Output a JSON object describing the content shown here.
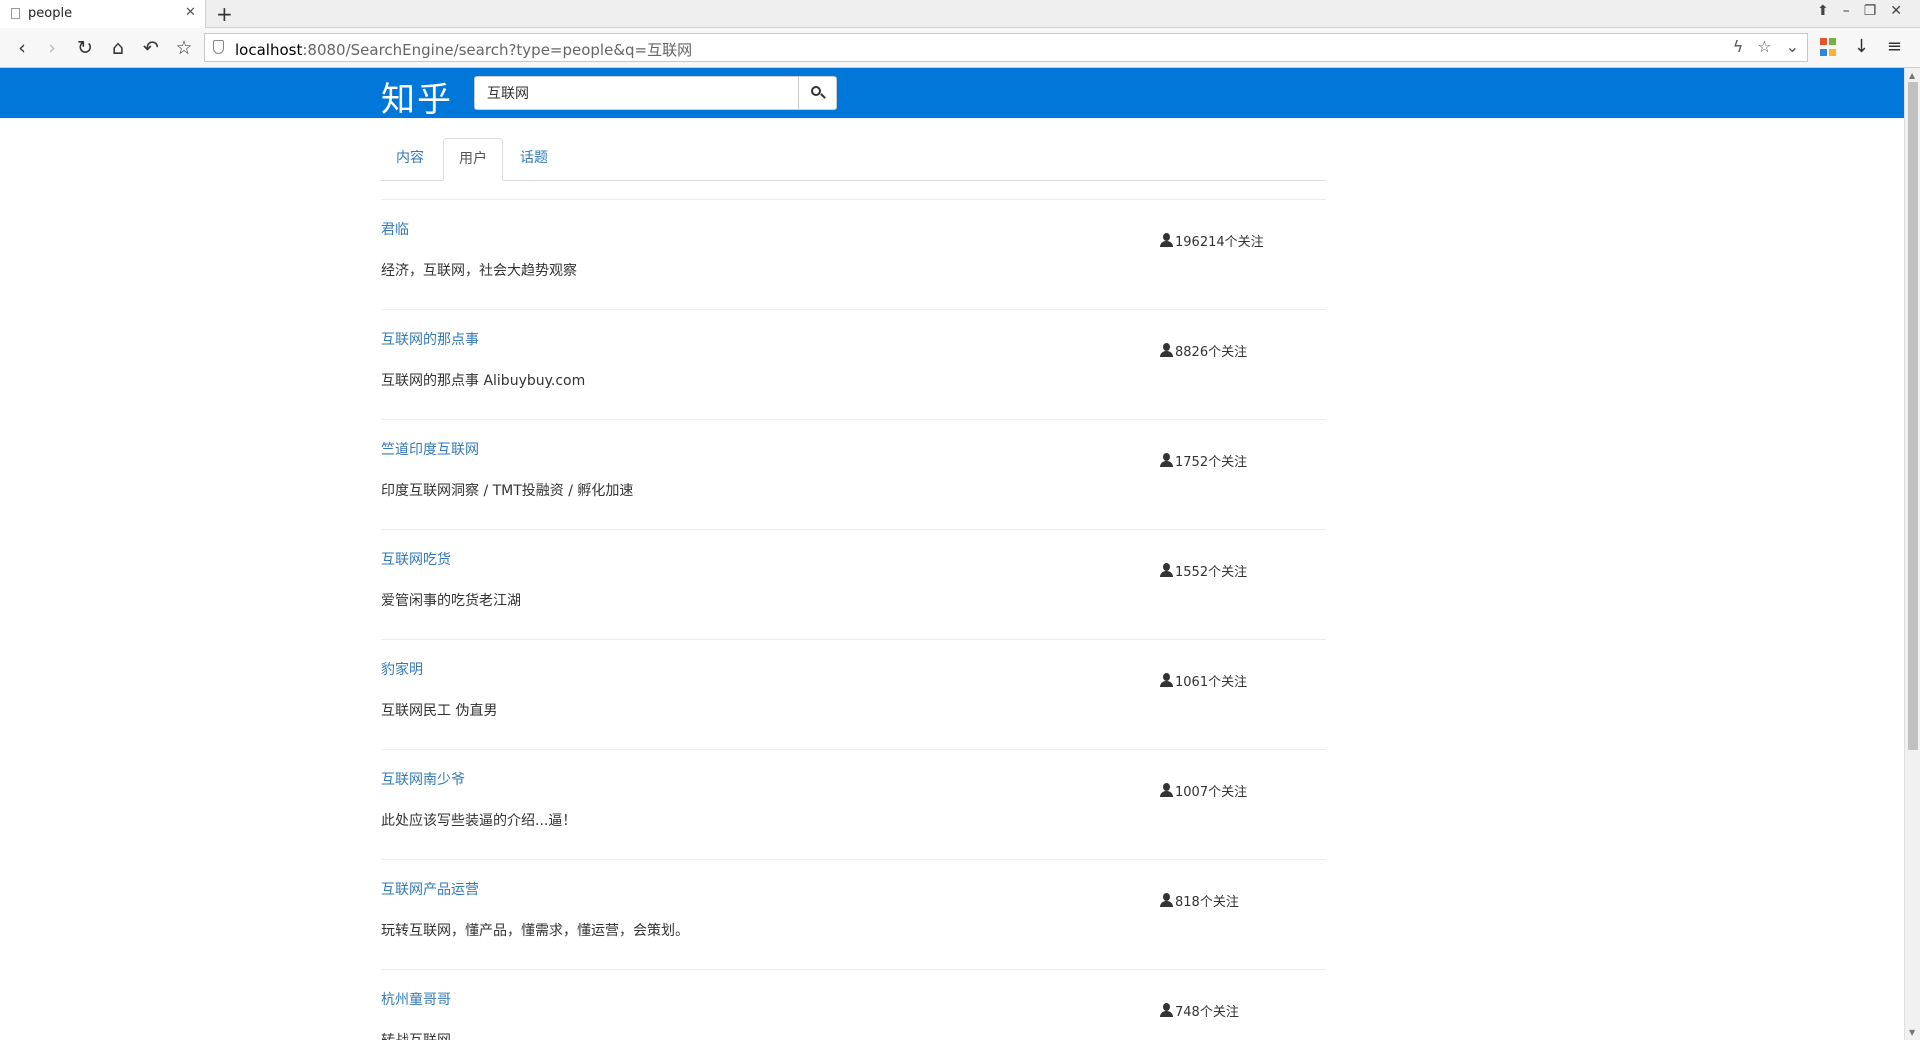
{
  "browser": {
    "tab_title": "people",
    "url_host": "localhost",
    "url_rest": ":8080/SearchEngine/search?type=people&q=互联网"
  },
  "header": {
    "logo": "知乎",
    "search_value": "互联网"
  },
  "tabs": [
    {
      "label": "内容",
      "active": false
    },
    {
      "label": "用户",
      "active": true
    },
    {
      "label": "话题",
      "active": false
    }
  ],
  "results": [
    {
      "name": "君临",
      "desc": "经济，互联网，社会大趋势观察",
      "followers": "196214个关注"
    },
    {
      "name": "互联网的那点事",
      "desc": "互联网的那点事 Alibuybuy.com",
      "followers": "8826个关注"
    },
    {
      "name": "竺道印度互联网",
      "desc": "印度互联网洞察 / TMT投融资 / 孵化加速",
      "followers": "1752个关注"
    },
    {
      "name": "互联网吃货",
      "desc": "爱管闲事的吃货老江湖",
      "followers": "1552个关注"
    },
    {
      "name": "豹家明",
      "desc": "互联网民工 伪直男",
      "followers": "1061个关注"
    },
    {
      "name": "互联网南少爷",
      "desc": "此处应该写些装逼的介绍...逼！",
      "followers": "1007个关注"
    },
    {
      "name": "互联网产品运营",
      "desc": "玩转互联网，懂产品，懂需求，懂运营，会策划。",
      "followers": "818个关注"
    },
    {
      "name": "杭州童哥哥",
      "desc": "转战互联网",
      "followers": "748个关注"
    }
  ]
}
